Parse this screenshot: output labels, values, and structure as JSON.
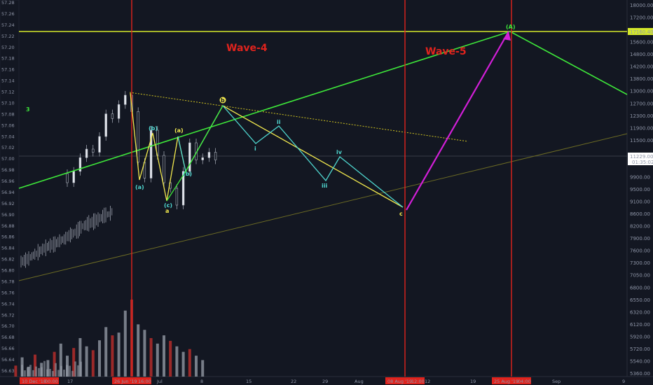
{
  "chart_data": {
    "type": "line",
    "annotations": {
      "wave4": "Wave-4",
      "wave5": "Wave-5",
      "count": "3",
      "labels": [
        "(a)",
        "(b)",
        "(c)",
        "a",
        "(a)",
        "(b)",
        "b",
        "i",
        "ii",
        "iii",
        "iv",
        "c",
        "(A)"
      ]
    },
    "left_axis_ticks": [
      "57.28",
      "57.26",
      "57.24",
      "57.22",
      "57.20",
      "57.18",
      "57.16",
      "57.14",
      "57.12",
      "57.10",
      "57.08",
      "57.06",
      "57.04",
      "57.02",
      "57.00",
      "56.98",
      "56.96",
      "56.94",
      "56.92",
      "56.90",
      "56.88",
      "56.86",
      "56.84",
      "56.82",
      "56.80",
      "56.78",
      "56.76",
      "56.74",
      "56.72",
      "56.70",
      "56.68",
      "56.66",
      "56.64",
      "56.63"
    ],
    "right_axis_ticks": [
      "18000.00",
      "17200.00",
      "16400.00",
      "15600.00",
      "14800.00",
      "14200.00",
      "13800.00",
      "13000.00",
      "12700.00",
      "12300.00",
      "11900.00",
      "11500.00",
      "10700.00",
      "10300.00",
      "9900.00",
      "9500.00",
      "9100.00",
      "8600.00",
      "8200.00",
      "7900.00",
      "7600.00",
      "7300.00",
      "7050.00",
      "6800.00",
      "6550.00",
      "6320.00",
      "6120.00",
      "5920.00",
      "5720.00",
      "5540.00",
      "5360.00"
    ],
    "right_axis_markers": {
      "target": "17160.40",
      "price": "11229.00",
      "countdown": "01:35:02"
    },
    "x_axis_ticks": [
      "17",
      "Jul",
      "8",
      "15",
      "22",
      "29",
      "Aug",
      "12",
      "19",
      "Sep",
      "9"
    ],
    "x_axis_markers": [
      "10 Dec '18",
      "00:00",
      "26 Jun '19",
      "16:00",
      "08 Aug '19",
      "12:00",
      "25 Aug '19",
      "04:00"
    ],
    "price_path": [
      [
        10700,
        "2019-06-15"
      ],
      [
        10300,
        "2019-06-16"
      ],
      [
        10800,
        "2019-06-17"
      ],
      [
        11400,
        "2019-06-18"
      ],
      [
        11700,
        "2019-06-19"
      ],
      [
        11600,
        "2019-06-20"
      ],
      [
        12100,
        "2019-06-21"
      ],
      [
        13000,
        "2019-06-22"
      ],
      [
        12800,
        "2019-06-23"
      ],
      [
        13400,
        "2019-06-24"
      ],
      [
        13800,
        "2019-06-25"
      ],
      [
        13100,
        "2019-06-26"
      ],
      [
        11200,
        "2019-06-27"
      ],
      [
        10500,
        "2019-06-28"
      ],
      [
        12300,
        "2019-06-29"
      ],
      [
        11500,
        "2019-06-30"
      ],
      [
        10300,
        "2019-07-01"
      ],
      [
        10100,
        "2019-07-02"
      ],
      [
        9500,
        "2019-07-03"
      ],
      [
        10800,
        "2019-07-04"
      ],
      [
        11900,
        "2019-07-05"
      ],
      [
        11300,
        "2019-07-06"
      ],
      [
        11400,
        "2019-07-07"
      ],
      [
        11600,
        "2019-07-08"
      ],
      [
        11300,
        "2019-07-09"
      ]
    ],
    "volume": [
      [
        20,
        "2019-06-08"
      ],
      [
        35,
        "2019-06-09"
      ],
      [
        18,
        "2019-06-10"
      ],
      [
        40,
        "2019-06-11"
      ],
      [
        25,
        "2019-06-12"
      ],
      [
        30,
        "2019-06-13"
      ],
      [
        45,
        "2019-06-14"
      ],
      [
        60,
        "2019-06-15"
      ],
      [
        38,
        "2019-06-16"
      ],
      [
        52,
        "2019-06-17"
      ],
      [
        70,
        "2019-06-18"
      ],
      [
        55,
        "2019-06-19"
      ],
      [
        48,
        "2019-06-20"
      ],
      [
        66,
        "2019-06-21"
      ],
      [
        90,
        "2019-06-22"
      ],
      [
        75,
        "2019-06-23"
      ],
      [
        80,
        "2019-06-24"
      ],
      [
        120,
        "2019-06-25"
      ],
      [
        140,
        "2019-06-26"
      ],
      [
        95,
        "2019-06-27"
      ],
      [
        85,
        "2019-06-28"
      ],
      [
        70,
        "2019-06-29"
      ],
      [
        60,
        "2019-06-30"
      ],
      [
        75,
        "2019-07-01"
      ],
      [
        65,
        "2019-07-02"
      ],
      [
        55,
        "2019-07-03"
      ],
      [
        45,
        "2019-07-04"
      ],
      [
        50,
        "2019-07-05"
      ],
      [
        38,
        "2019-07-06"
      ],
      [
        30,
        "2019-07-07"
      ]
    ],
    "colors": {
      "background": "#131722",
      "vertical_marker": "#e0231d",
      "target_line": "#d4e82b",
      "trend_green": "#3ee83a",
      "wave_yellow": "#f2e94e",
      "wave_cyan": "#4fd7d0",
      "projection": "#d21fd8",
      "dotted_trend": "#d1c521",
      "lower_trend": "#6b6a24",
      "wave4_text": "#e0231d",
      "count_text": "#3ee83a"
    }
  }
}
